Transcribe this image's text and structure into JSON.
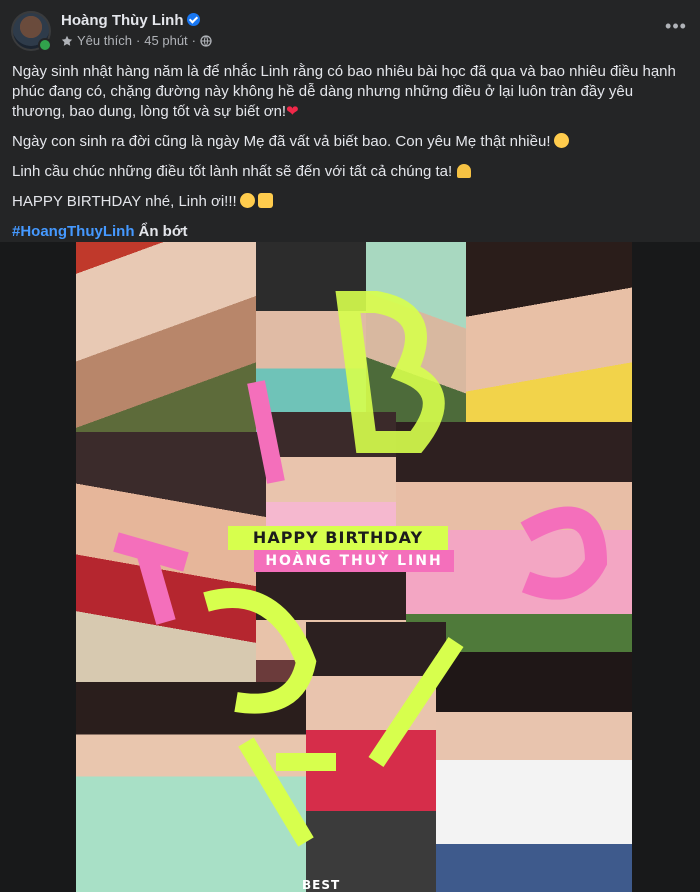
{
  "author": {
    "name": "Hoàng Thùy Linh"
  },
  "meta": {
    "reaction_label": "Yêu thích",
    "separator": "·",
    "time": "45 phút"
  },
  "more_label": "•••",
  "post": {
    "paragraphs": [
      "Ngày sinh nhật hàng năm là để nhắc Linh rằng có bao nhiêu bài học đã qua và bao nhiêu điều hạnh phúc đang có, chặng đường này không hề dễ dàng nhưng những điều ở lại luôn tràn đầy yêu thương, bao dung, lòng tốt và sự biết ơn!",
      "Ngày con sinh ra đời cũng là ngày Mẹ đã vất vả biết bao. Con yêu Mẹ thật nhiều!",
      "Linh cầu chúc những điều tốt lành nhất sẽ đến với tất cả chúng ta!",
      "HAPPY BIRTHDAY nhé, Linh ơi!!!"
    ],
    "hashtag": "#HoangThuyLinh",
    "see_less": "Ẩn bớt"
  },
  "image": {
    "banner_line1": "HAPPY BIRTHDAY",
    "banner_line2": "HOÀNG THUỲ LINH",
    "footer_text": "BEST WISHES"
  },
  "colors": {
    "bg": "#242526",
    "text": "#e4e6eb",
    "secondary": "#b0b3b8",
    "hashtag": "#4599ff",
    "verified": "#1877f2",
    "online": "#31a24c",
    "heart": "#f02849",
    "banner_green": "#d7ff4d",
    "banner_pink": "#f46fbb"
  }
}
